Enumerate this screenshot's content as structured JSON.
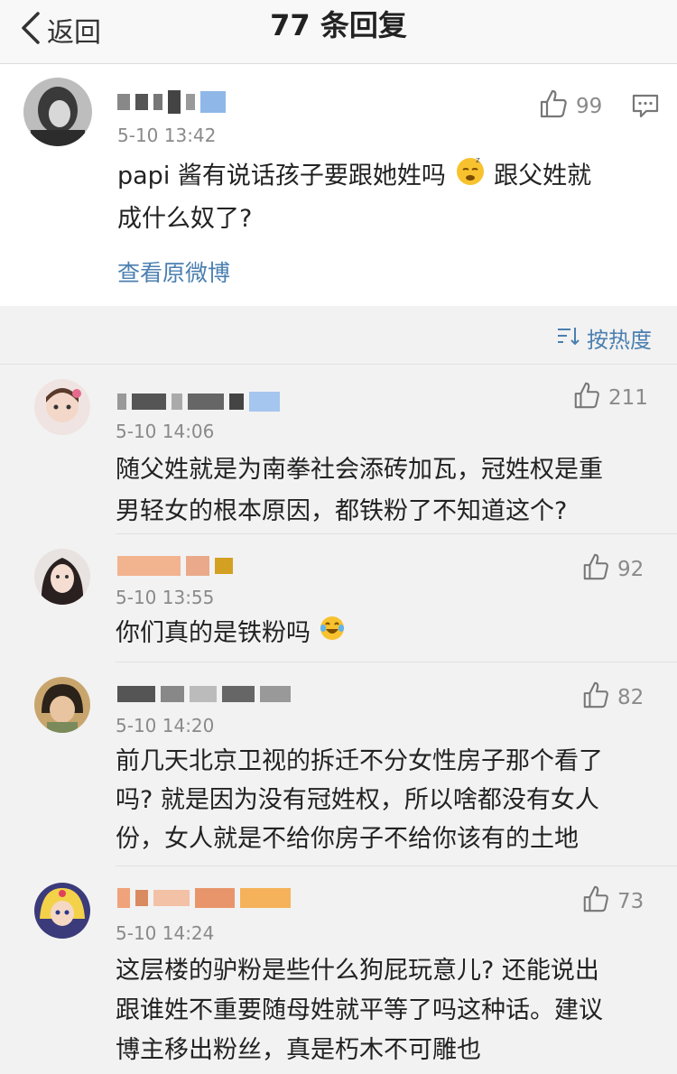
{
  "header": {
    "back_label": "返回",
    "title": "77 条回复"
  },
  "post": {
    "time": "5-10 13:42",
    "likes": "99",
    "text_line1": "papi 酱有说话孩子要跟她姓吗",
    "text_line1b": "跟父姓就",
    "text_line2": "成什么奴了?",
    "link": "查看原微博"
  },
  "sort": {
    "label": "按热度"
  },
  "comments": [
    {
      "time": "5-10 14:06",
      "likes": "211",
      "lines": [
        "随父姓就是为南拳社会添砖加瓦，冠姓权是重",
        "男轻女的根本原因，都铁粉了不知道这个?"
      ]
    },
    {
      "time": "5-10 13:55",
      "likes": "92",
      "lines": [
        "你们真的是铁粉吗"
      ]
    },
    {
      "time": "5-10 14:20",
      "likes": "82",
      "lines": [
        "前几天北京卫视的拆迁不分女性房子那个看了",
        "吗? 就是因为没有冠姓权，所以啥都没有女人",
        "份，女人就是不给你房子不给你该有的土地"
      ]
    },
    {
      "time": "5-10 14:24",
      "likes": "73",
      "lines": [
        "这层楼的驴粉是些什么狗屁玩意儿? 还能说出",
        "跟谁姓不重要随母姓就平等了吗这种话。建议",
        "博主移出粉丝，真是朽木不可雕也"
      ]
    }
  ]
}
